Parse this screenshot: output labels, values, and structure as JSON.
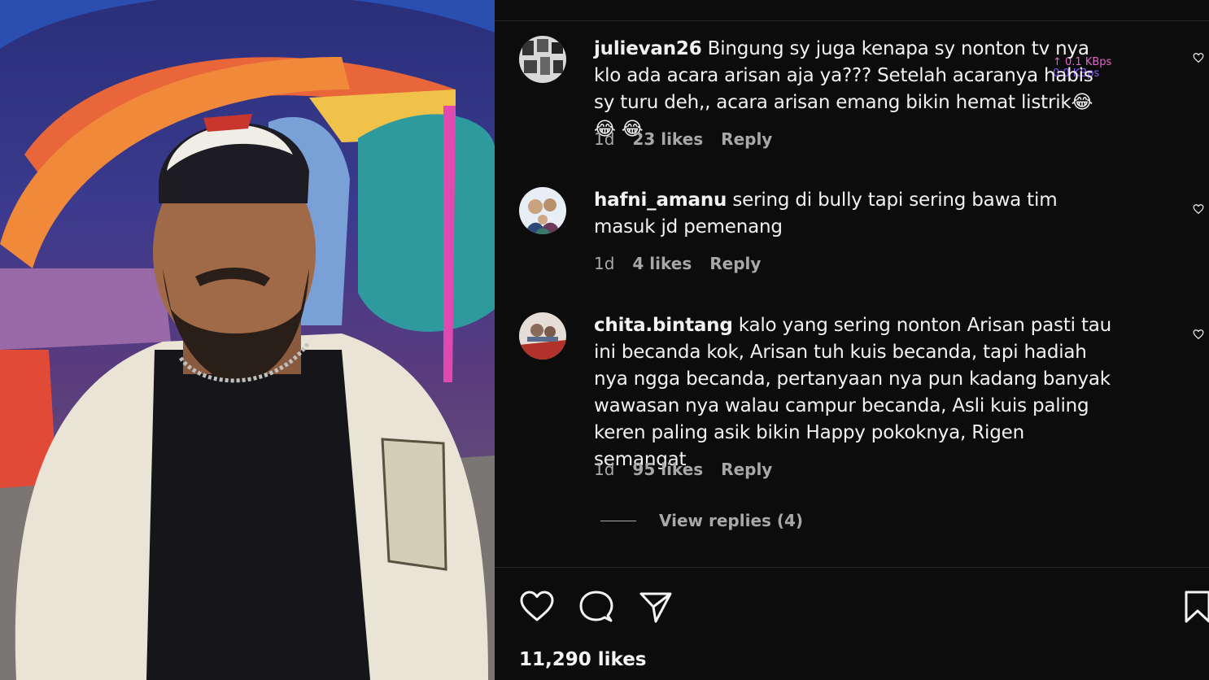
{
  "post": {
    "comments": [
      {
        "username": "julievan26",
        "text": "Bingung sy juga kenapa sy nonton tv nya klo ada acara arisan aja ya??? Setelah acaranya habis sy turu deh,, acara arisan emang bikin hemat listrik😂 😂 😂",
        "time": "1d",
        "likes": "23 likes",
        "reply": "Reply"
      },
      {
        "username": "hafni_amanu",
        "text": "sering di bully tapi sering bawa tim masuk jd pemenang",
        "time": "1d",
        "likes": "4 likes",
        "reply": "Reply"
      },
      {
        "username": "chita.bintang",
        "text": "kalo yang sering nonton Arisan pasti tau ini becanda kok, Arisan tuh kuis becanda, tapi hadiah nya ngga becanda, pertanyaan nya pun kadang banyak wawasan nya walau campur becanda, Asli kuis paling keren paling asik bikin Happy pokoknya, Rigen semangat",
        "time": "1d",
        "likes": "95 likes",
        "reply": "Reply"
      }
    ],
    "view_replies": "View replies (4)",
    "total_likes": "11,290 likes"
  },
  "overlay": {
    "upload_speed": "↑ 0.1 KBps",
    "download_speed": "0.0 KBps"
  },
  "icons": {
    "like": "heart-icon",
    "comment": "comment-bubble-icon",
    "share": "send-icon",
    "save": "bookmark-icon",
    "comment_like": "heart-small-icon"
  },
  "colors": {
    "background": "#0c0c0c",
    "text": "#f5f5f5",
    "secondary_text": "#a8a8a8",
    "divider": "#262626"
  }
}
